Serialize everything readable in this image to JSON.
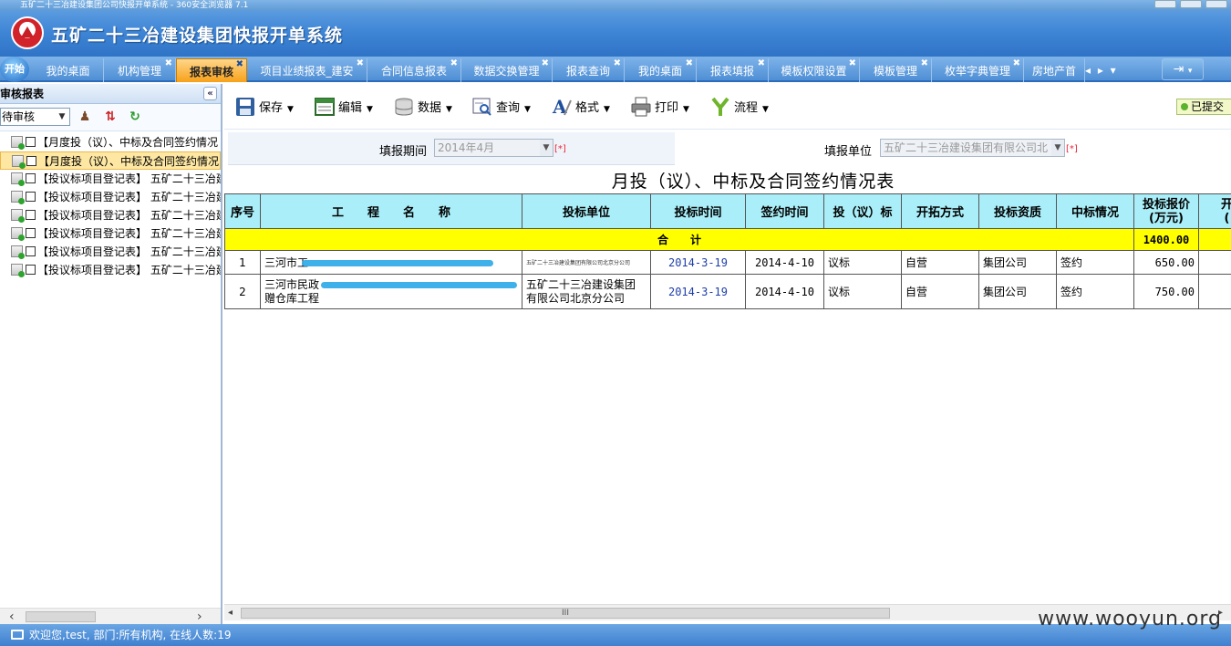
{
  "browser": {
    "title": "五矿二十三冶建设集团公司快报开单系统 - 360安全浏览器 7.1"
  },
  "app": {
    "title": "五矿二十三冶建设集团快报开单系统"
  },
  "tabs": {
    "start": "开始",
    "items": [
      "我的桌面",
      "机构管理",
      "报表审核",
      "项目业绩报表_建安",
      "合同信息报表",
      "数据交换管理",
      "报表查询",
      "我的桌面",
      "报表填报",
      "模板权限设置",
      "模板管理",
      "枚举字典管理",
      "房地产首"
    ],
    "active_index": 2,
    "nav": "◂ ▸ ▾"
  },
  "sidebar": {
    "title": "审核报表",
    "collapse": "«",
    "status_value": "待审核",
    "items": [
      "【月度投（议）、中标及合同签约情况",
      "【月度投（议）、中标及合同签约情况",
      "【投议标项目登记表】 五矿二十三冶建",
      "【投议标项目登记表】 五矿二十三冶建",
      "【投议标项目登记表】 五矿二十三冶建",
      "【投议标项目登记表】 五矿二十三冶建",
      "【投议标项目登记表】 五矿二十三冶建",
      "【投议标项目登记表】 五矿二十三冶建"
    ],
    "selected_index": 1
  },
  "toolbar": {
    "save": "保存",
    "edit": "编辑",
    "data": "数据",
    "query": "查询",
    "format": "格式",
    "print": "打印",
    "flow": "流程",
    "submitted": "已提交"
  },
  "form": {
    "period_label": "填报期间",
    "period_value": "2014年4月",
    "unit_label": "填报单位",
    "unit_value": "五矿二十三冶建设集团有限公司北",
    "required_mark": "[*]"
  },
  "report": {
    "title": "月投（议）、中标及合同签约情况表",
    "headers": [
      "序号",
      "工　　程　　名　　称",
      "投标单位",
      "投标时间",
      "签约时间",
      "投（议）标",
      "开拓方式",
      "投标资质",
      "中标情况",
      "投标报价\n(万元)",
      "开\n("
    ],
    "total_label": "合　　计",
    "total_value": "1400.00",
    "rows": [
      {
        "no": "1",
        "name": "三河市工",
        "unit": "五矿二十三冶建设集团有限公司北京分公司",
        "bid_date": "2014-3-19",
        "sign_date": "2014-4-10",
        "bid_type": "议标",
        "method": "自营",
        "qualification": "集团公司",
        "result": "签约",
        "price": "650.00"
      },
      {
        "no": "2",
        "name": "三河市民政",
        "name2": "赠仓库工程",
        "unit": "五矿二十三冶建设集团",
        "unit2": "有限公司北京分公司",
        "bid_date": "2014-3-19",
        "sign_date": "2014-4-10",
        "bid_type": "议标",
        "method": "自营",
        "qualification": "集团公司",
        "result": "签约",
        "price": "750.00"
      }
    ]
  },
  "status": {
    "text": "欢迎您,test, 部门:所有机构, 在线人数:19"
  },
  "watermark": "www.wooyun.org"
}
